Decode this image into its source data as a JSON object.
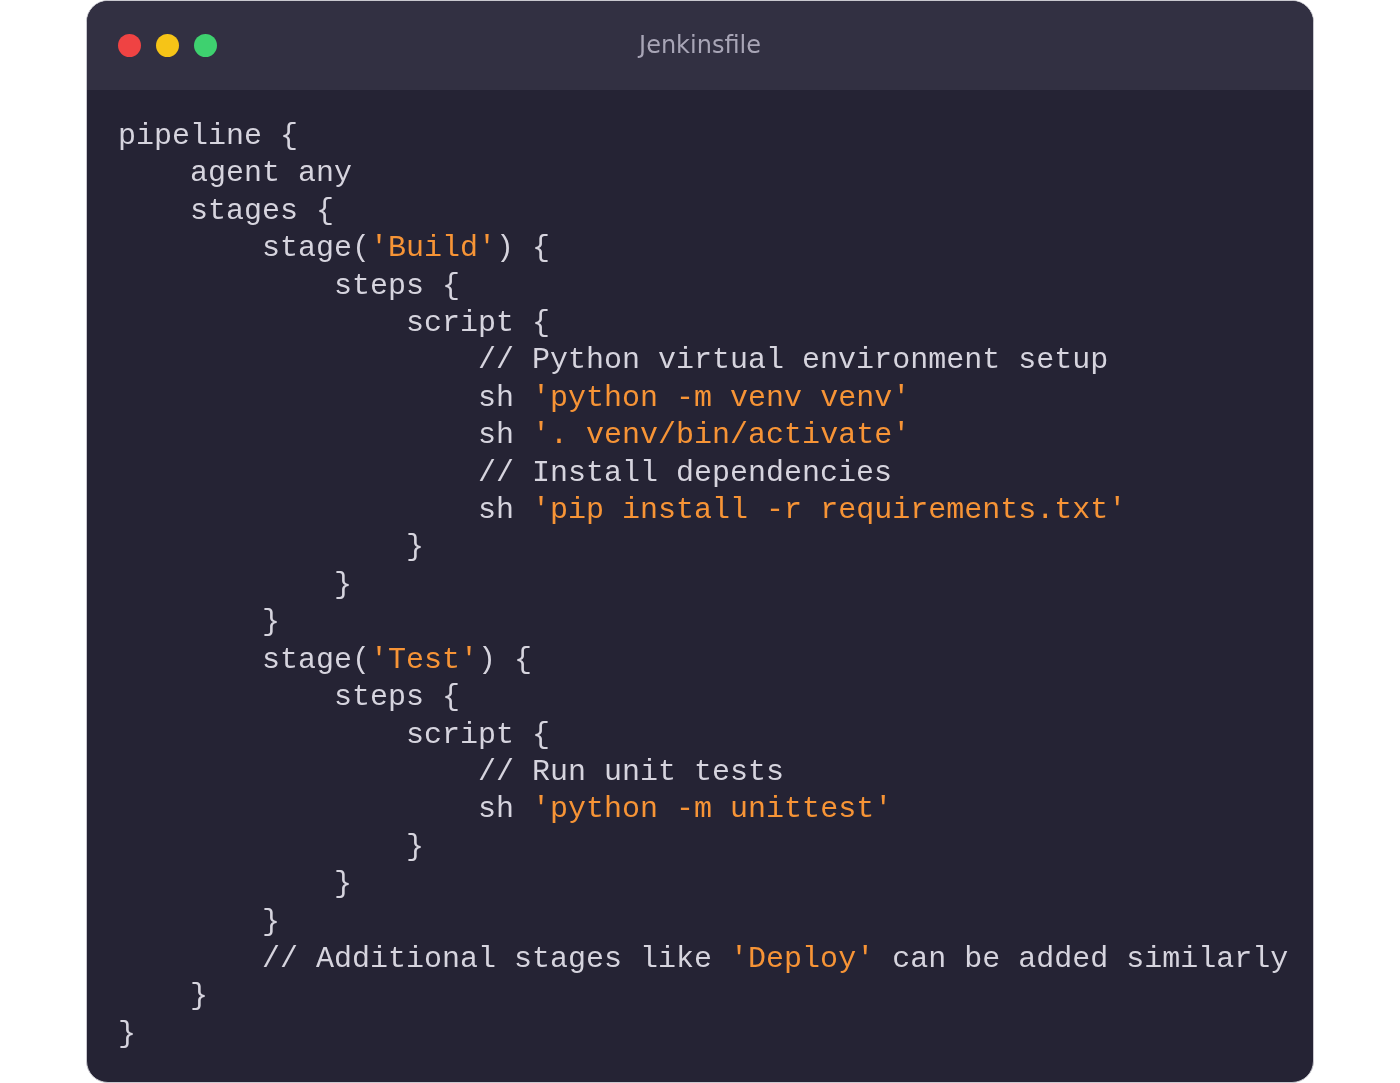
{
  "window": {
    "title": "Jenkinsfile",
    "buttons": [
      {
        "color": "#ef4343"
      },
      {
        "color": "#f6c417"
      },
      {
        "color": "#3ed16f"
      }
    ]
  },
  "code": [
    [
      {
        "kind": "plain",
        "text": "pipeline {"
      }
    ],
    [
      {
        "kind": "plain",
        "text": "    agent any"
      }
    ],
    [
      {
        "kind": "plain",
        "text": "    stages {"
      }
    ],
    [
      {
        "kind": "plain",
        "text": "        stage("
      },
      {
        "kind": "string",
        "text": "'Build'"
      },
      {
        "kind": "plain",
        "text": ") {"
      }
    ],
    [
      {
        "kind": "plain",
        "text": "            steps {"
      }
    ],
    [
      {
        "kind": "plain",
        "text": "                script {"
      }
    ],
    [
      {
        "kind": "comment",
        "text": "                    // Python virtual environment setup"
      }
    ],
    [
      {
        "kind": "plain",
        "text": "                    sh "
      },
      {
        "kind": "string",
        "text": "'python -m venv venv'"
      }
    ],
    [
      {
        "kind": "plain",
        "text": "                    sh "
      },
      {
        "kind": "string",
        "text": "'. venv/bin/activate'"
      }
    ],
    [
      {
        "kind": "comment",
        "text": "                    // Install dependencies"
      }
    ],
    [
      {
        "kind": "plain",
        "text": "                    sh "
      },
      {
        "kind": "string",
        "text": "'pip install -r requirements.txt'"
      }
    ],
    [
      {
        "kind": "plain",
        "text": "                }"
      }
    ],
    [
      {
        "kind": "plain",
        "text": "            }"
      }
    ],
    [
      {
        "kind": "plain",
        "text": "        }"
      }
    ],
    [
      {
        "kind": "plain",
        "text": "        stage("
      },
      {
        "kind": "string",
        "text": "'Test'"
      },
      {
        "kind": "plain",
        "text": ") {"
      }
    ],
    [
      {
        "kind": "plain",
        "text": "            steps {"
      }
    ],
    [
      {
        "kind": "plain",
        "text": "                script {"
      }
    ],
    [
      {
        "kind": "comment",
        "text": "                    // Run unit tests"
      }
    ],
    [
      {
        "kind": "plain",
        "text": "                    sh "
      },
      {
        "kind": "string",
        "text": "'python -m unittest'"
      }
    ],
    [
      {
        "kind": "plain",
        "text": "                }"
      }
    ],
    [
      {
        "kind": "plain",
        "text": "            }"
      }
    ],
    [
      {
        "kind": "plain",
        "text": "        }"
      }
    ],
    [
      {
        "kind": "comment",
        "text": "        // Additional stages like "
      },
      {
        "kind": "string",
        "text": "'Deploy'"
      },
      {
        "kind": "comment",
        "text": " can be added similarly"
      }
    ],
    [
      {
        "kind": "plain",
        "text": "    }"
      }
    ],
    [
      {
        "kind": "plain",
        "text": "}"
      }
    ]
  ]
}
